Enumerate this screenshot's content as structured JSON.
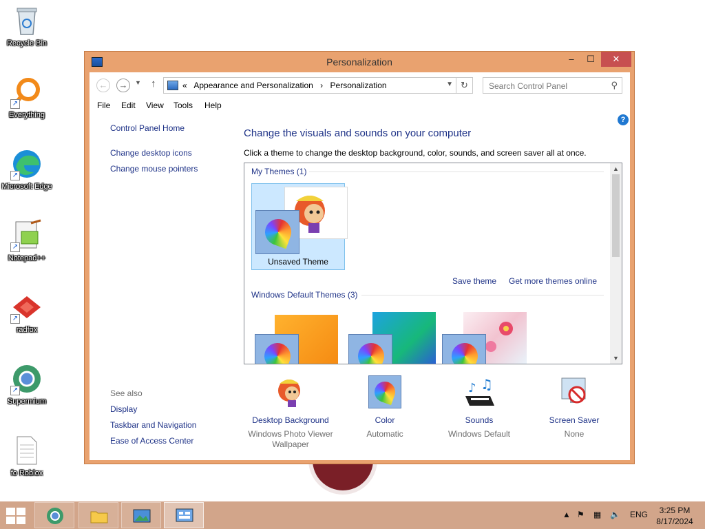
{
  "desktop": {
    "icons": [
      {
        "label": "Recycle Bin"
      },
      {
        "label": "Everything"
      },
      {
        "label": "Microsoft Edge"
      },
      {
        "label": "Notepad++"
      },
      {
        "label": "radfox"
      },
      {
        "label": "Supermium"
      },
      {
        "label": "fo Roblox"
      }
    ]
  },
  "window": {
    "title": "Personalization",
    "min": "–",
    "max": "☐",
    "close": "✕"
  },
  "address": {
    "chevron": "«",
    "crumbs": [
      "Appearance and Personalization",
      "Personalization"
    ],
    "separator": "›",
    "search_placeholder": "Search Control Panel"
  },
  "menu": [
    "File",
    "Edit",
    "View",
    "Tools",
    "Help"
  ],
  "left_pane": {
    "home": "Control Panel Home",
    "links": [
      "Change desktop icons",
      "Change mouse pointers"
    ],
    "see_also_title": "See also",
    "see_also": [
      "Display",
      "Taskbar and Navigation",
      "Ease of Access Center"
    ]
  },
  "main": {
    "heading": "Change the visuals and sounds on your computer",
    "description": "Click a theme to change the desktop background, color, sounds, and screen saver all at once.",
    "my_themes_header": "My Themes (1)",
    "unsaved_theme": "Unsaved Theme",
    "save_theme": "Save theme",
    "get_more": "Get more themes online",
    "default_themes_header": "Windows Default Themes (3)"
  },
  "bottom": [
    {
      "label": "Desktop Background",
      "sub": "Windows Photo Viewer Wallpaper"
    },
    {
      "label": "Color",
      "sub": "Automatic"
    },
    {
      "label": "Sounds",
      "sub": "Windows Default"
    },
    {
      "label": "Screen Saver",
      "sub": "None"
    }
  ],
  "taskbar": {
    "language": "ENG",
    "time": "3:25 PM",
    "date": "8/17/2024"
  },
  "colors": {
    "window_frame": "#e9a26f",
    "taskbar": "#d2a58a",
    "link": "#1e3287",
    "close": "#c75050"
  }
}
